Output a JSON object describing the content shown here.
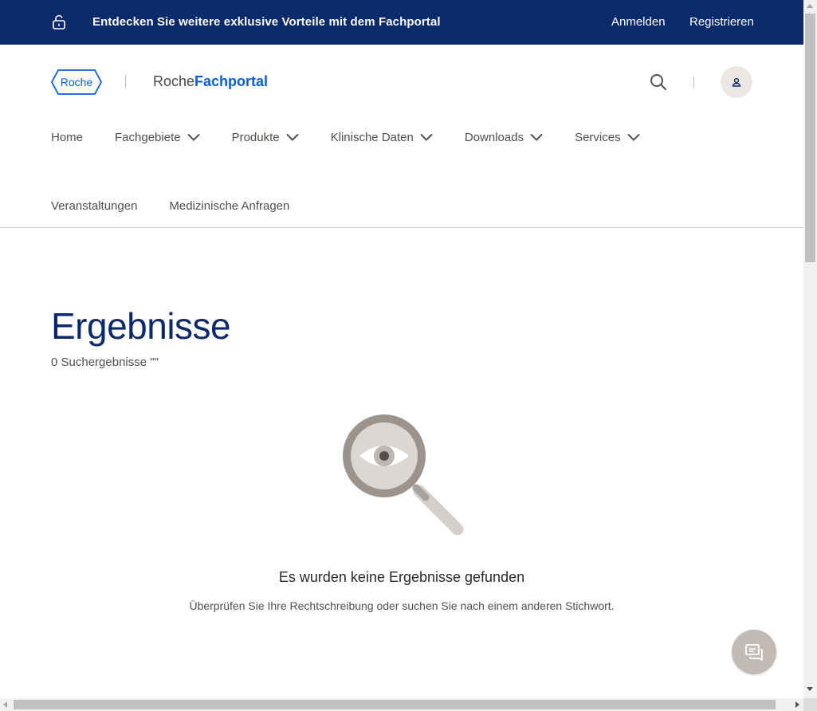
{
  "banner": {
    "message": "Entdecken Sie weitere exklusive Vorteile mit dem Fachportal",
    "login_label": "Anmelden",
    "register_label": "Registrieren",
    "background": "#0b2a6b"
  },
  "header": {
    "logo_text": "Roche",
    "portal_prefix": "Roche",
    "portal_brand": "Fachportal",
    "brand_color": "#0b5ed7",
    "icons": [
      "unlock-icon",
      "search-icon",
      "user-icon"
    ]
  },
  "nav": {
    "items": [
      {
        "label": "Home",
        "has_dropdown": false
      },
      {
        "label": "Fachgebiete",
        "has_dropdown": true
      },
      {
        "label": "Produkte",
        "has_dropdown": true
      },
      {
        "label": "Klinische Daten",
        "has_dropdown": true
      },
      {
        "label": "Downloads",
        "has_dropdown": true
      },
      {
        "label": "Services",
        "has_dropdown": true
      },
      {
        "label": "Veranstaltungen",
        "has_dropdown": false
      },
      {
        "label": "Medizinische Anfragen",
        "has_dropdown": false
      }
    ]
  },
  "main": {
    "title": "Ergebnisse",
    "result_count": "0 Suchergebnisse \"\"",
    "empty_title": "Es wurden keine Ergebnisse gefunden",
    "empty_hint": "Überprüfen Sie Ihre Rechtschreibung oder suchen Sie nach einem anderen Stichwort.",
    "title_color": "#0b2a6b",
    "illustration": "magnifier-eye-icon"
  },
  "chat": {
    "icon": "chat-icon",
    "color": "#c2bab4"
  }
}
